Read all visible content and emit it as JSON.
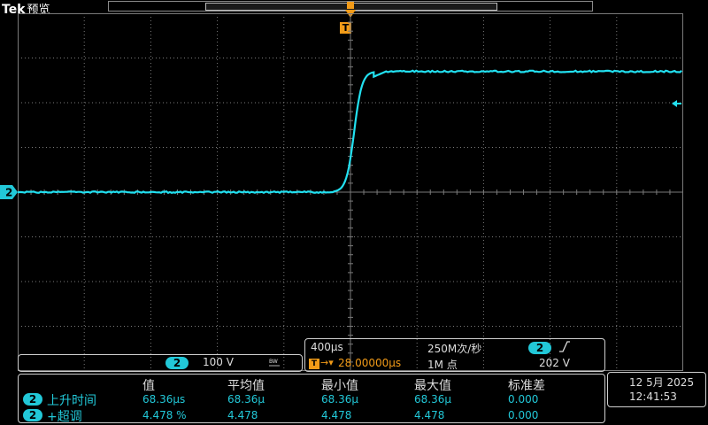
{
  "header": {
    "brand": "Tek",
    "mode": "预览"
  },
  "channel": {
    "number": "2",
    "scale": "100 V",
    "bw_icon": "BW"
  },
  "horizontal": {
    "time_per_div": "400µs",
    "sample_rate": "250M次/秒",
    "record_length": "1M 点",
    "trigger_position": "28.00000µs",
    "trigger_source": "2",
    "trigger_slope_icon": "rising-edge",
    "trigger_level": "202 V"
  },
  "measurements": {
    "headers": [
      "值",
      "平均值",
      "最小值",
      "最大值",
      "标准差"
    ],
    "rows": [
      {
        "source": "2",
        "name": "上升时间",
        "values": [
          "68.36µs",
          "68.36µ",
          "68.36µ",
          "68.36µ",
          "0.000"
        ]
      },
      {
        "source": "2",
        "name": "+超调",
        "values": [
          "4.478 %",
          "4.478",
          "4.478",
          "4.478",
          "0.000"
        ]
      }
    ]
  },
  "datetime": {
    "date": "12 5月 2025",
    "time": "12:41:53"
  },
  "colors": {
    "trace": "#22e0f0",
    "trigger": "#f29b18",
    "grid": "#7a7a7a",
    "channel_badge": "#22c8d8"
  },
  "waveform": {
    "low_level_div": 0.0,
    "high_level_div": 2.7,
    "rise_start_div": 0.0,
    "rise_end_div": 0.35
  }
}
